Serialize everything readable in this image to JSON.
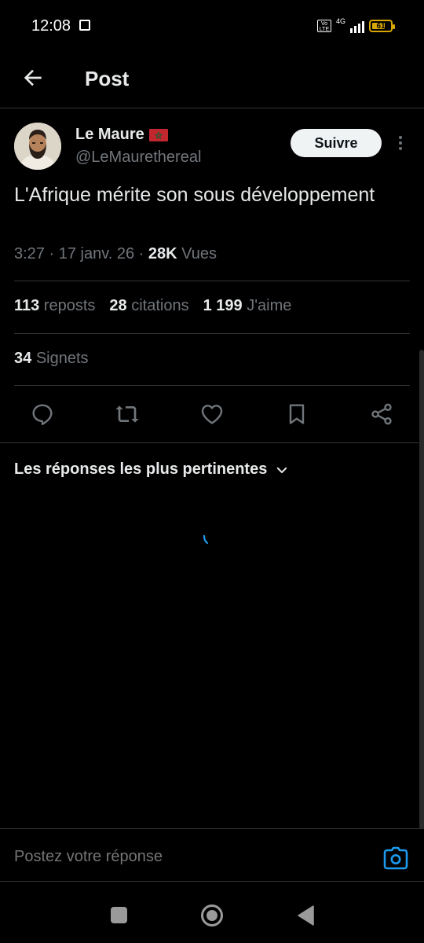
{
  "status_bar": {
    "time": "12:08",
    "volte_label": "Vo LTE",
    "network": "4G",
    "battery_level": "61"
  },
  "header": {
    "title": "Post"
  },
  "post": {
    "author_name": "Le Maure",
    "author_handle": "@LeMaurethereal",
    "follow_label": "Suivre",
    "text": "L'Afrique mérite son sous développement",
    "time": "3:27",
    "date": "17 janv. 26",
    "views_count": "28K",
    "views_label": "Vues"
  },
  "stats": {
    "reposts_count": "113",
    "reposts_label": "reposts",
    "quotes_count": "28",
    "quotes_label": "citations",
    "likes_count": "1 199",
    "likes_label": "J'aime",
    "bookmarks_count": "34",
    "bookmarks_label": "Signets"
  },
  "actions": [
    "reply-icon",
    "repost-icon",
    "like-icon",
    "bookmark-icon",
    "share-icon"
  ],
  "replies": {
    "sort_label": "Les réponses les plus pertinentes"
  },
  "reply_bar": {
    "placeholder": "Postez votre réponse"
  },
  "colors": {
    "background": "#000000",
    "text": "#e7e9ea",
    "muted": "#71767b",
    "divider": "#2f3336",
    "accent": "#1d9bf0",
    "battery": "#d9a800"
  }
}
